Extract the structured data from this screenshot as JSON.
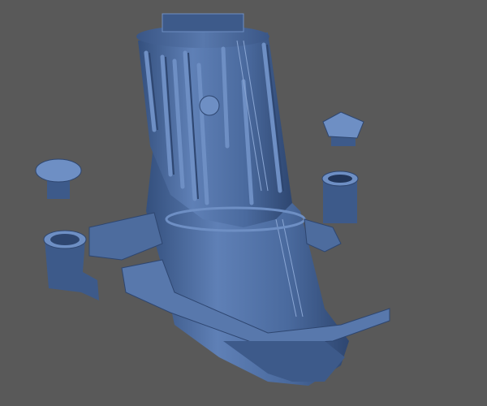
{
  "scene": {
    "subject": "funnel-model-render",
    "colors": {
      "background": "#595959",
      "model_base": "#4d6c9e",
      "model_light": "#6e8fc4",
      "model_dark": "#2e4670",
      "model_shadow": "#22365a"
    }
  }
}
